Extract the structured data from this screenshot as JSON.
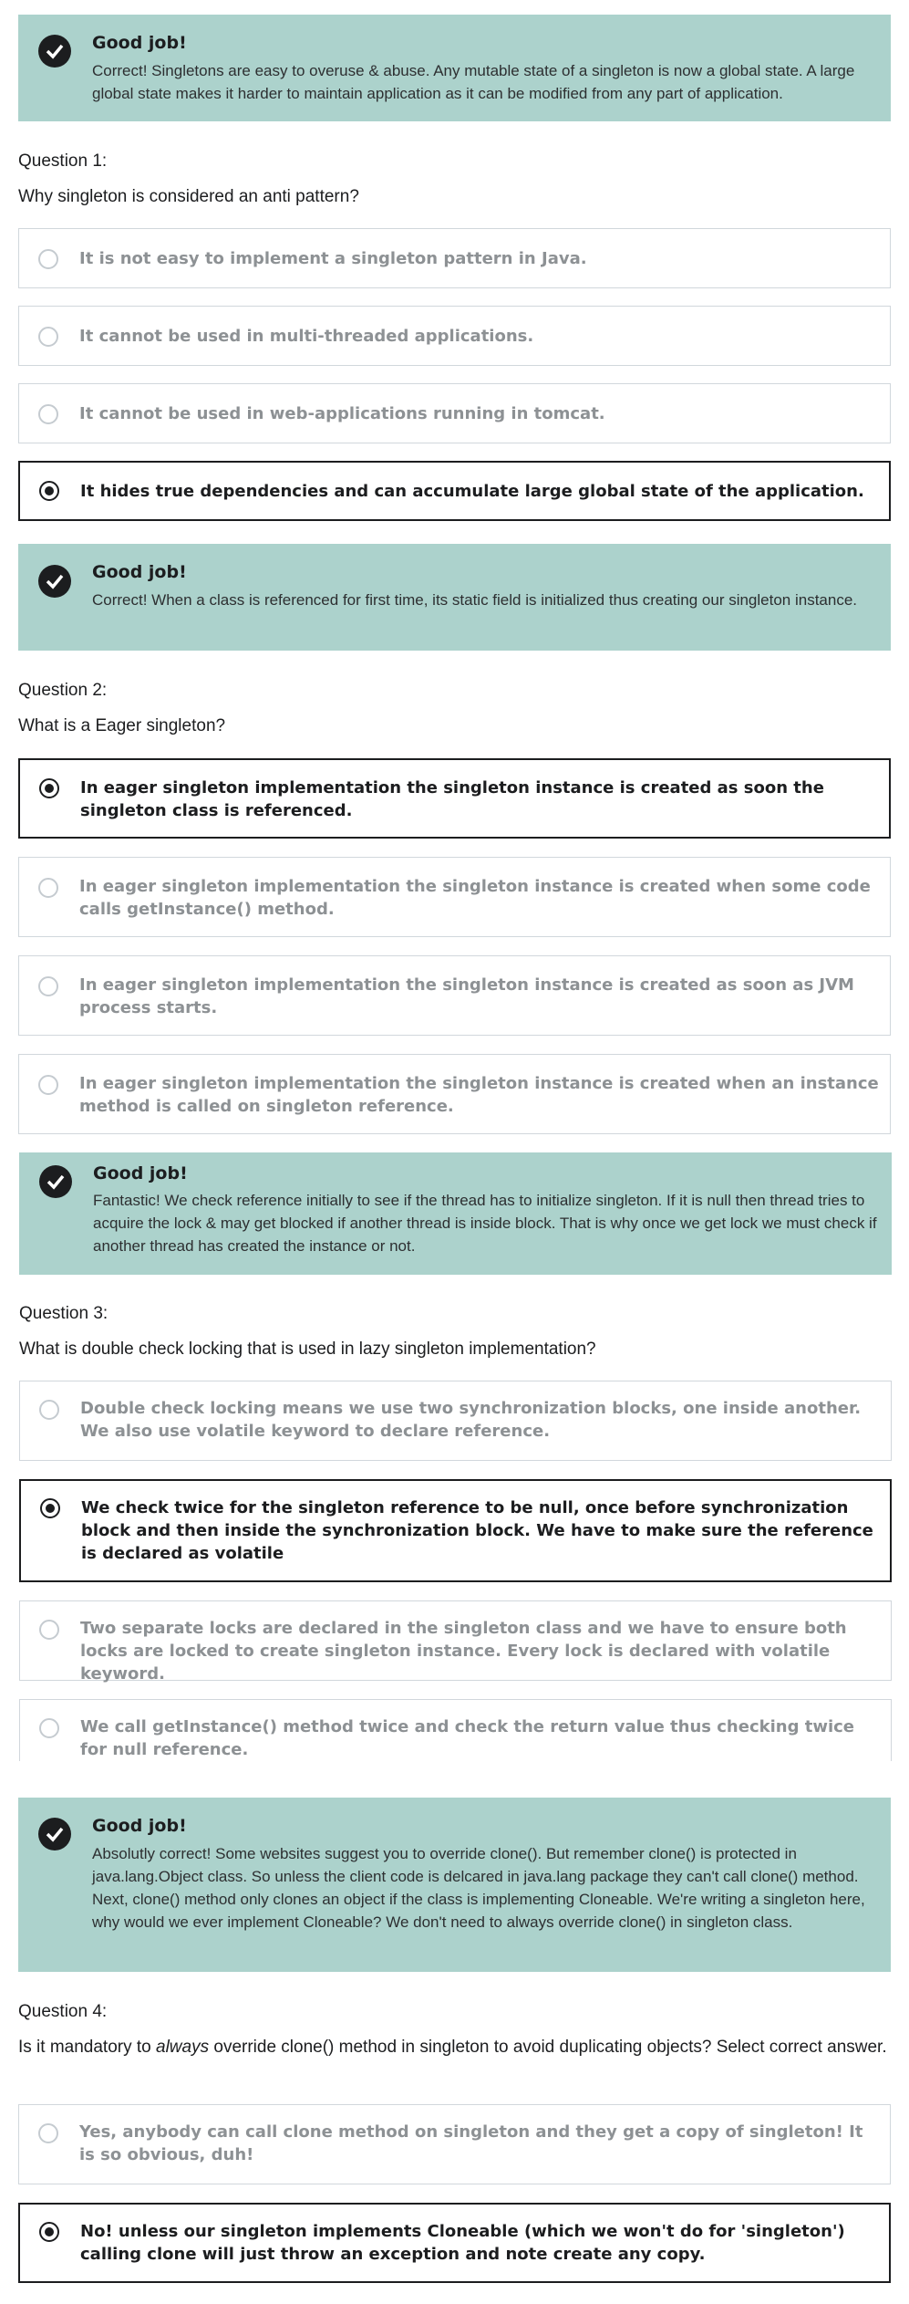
{
  "feedback": [
    {
      "title": "Good job!",
      "message": "Correct! Singletons are easy to overuse & abuse. Any mutable state of a singleton is now a global state. A large global state makes it harder to maintain application as it can be modified from any part of application."
    },
    {
      "title": "Good job!",
      "message": "Correct! When a class is referenced for first time, its static field is initialized thus creating our singleton instance."
    },
    {
      "title": "Good job!",
      "message": "Fantastic! We check reference initially to see if the thread has to initialize singleton. If it is null then thread tries to acquire the lock & may get blocked if another thread is inside block. That is why once we get lock we must check if another thread has created the instance or not."
    },
    {
      "title": "Good job!",
      "message": "Absolutly correct! Some websites suggest you to override clone(). But remember clone() is protected in java.lang.Object class. So unless the client code is delcared in java.lang package they can't call clone() method. Next, clone() method only clones an object if the class is implementing Cloneable. We're writing a singleton here, why would we ever implement Cloneable? We don't need to always override clone() in singleton class."
    }
  ],
  "questions": [
    {
      "number": "Question 1:",
      "text": "Why singleton is considered an anti pattern?",
      "options": [
        {
          "label": "It is not easy to implement a singleton pattern in Java.",
          "selected": false
        },
        {
          "label": "It cannot be used in multi-threaded applications.",
          "selected": false
        },
        {
          "label": "It cannot be used in web-applications running in tomcat.",
          "selected": false
        },
        {
          "label": "It hides true dependencies and can accumulate large global state of the application.",
          "selected": true
        }
      ]
    },
    {
      "number": "Question 2:",
      "text": "What is a Eager singleton?",
      "options": [
        {
          "label": "In eager singleton implementation the singleton instance is created as soon the singleton class is referenced.",
          "selected": true
        },
        {
          "label": "In eager singleton implementation the singleton instance is created when some code calls getInstance() method.",
          "selected": false
        },
        {
          "label": "In eager singleton implementation the singleton instance is created as soon as JVM process starts.",
          "selected": false
        },
        {
          "label": "In eager singleton implementation the singleton instance is created when an instance method is called on singleton reference.",
          "selected": false
        }
      ]
    },
    {
      "number": "Question 3:",
      "text": "What is double check locking that is used in lazy singleton implementation?",
      "options": [
        {
          "label": "Double check locking means we use two synchronization blocks, one inside another. We also use volatile keyword to declare reference.",
          "selected": false
        },
        {
          "label": "We check twice for the singleton reference to be null, once before synchronization block and then inside the synchronization block. We have to make sure the reference is declared as volatile",
          "selected": true
        },
        {
          "label": "Two separate locks are declared in the singleton class and we have to ensure both locks are locked to create singleton instance. Every lock is declared with volatile keyword.",
          "selected": false
        },
        {
          "label": "We call getInstance() method twice and check the return value thus checking twice for null reference.",
          "selected": false
        }
      ]
    },
    {
      "number": "Question 4:",
      "text_before": "Is it mandatory to ",
      "text_emphasis": "always",
      "text_after": " override clone() method in singleton to avoid duplicating objects? Select correct answer.",
      "options": [
        {
          "label": "Yes, anybody can call clone method on singleton and they get a copy of singleton! It is so obvious, duh!",
          "selected": false
        },
        {
          "label": "No! unless our singleton implements Cloneable (which we won't do for 'singleton') calling clone will just throw an exception and note create any copy.",
          "selected": true
        }
      ]
    }
  ]
}
